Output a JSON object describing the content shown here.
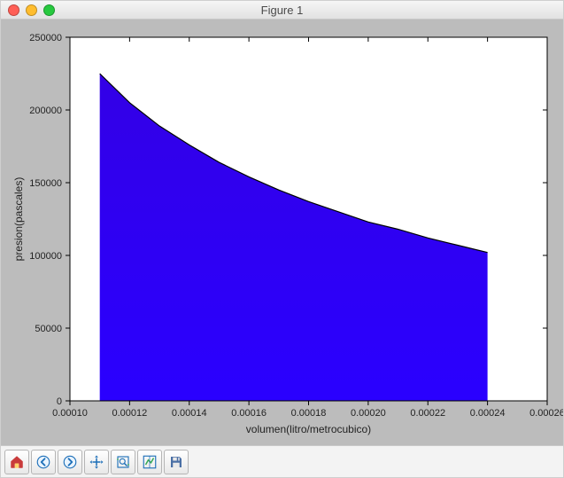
{
  "window": {
    "title": "Figure 1"
  },
  "chart_data": {
    "type": "area",
    "xlabel": "volumen(litro/metrocubico)",
    "ylabel": "presion(pascales)",
    "xlim": [
      0.0001,
      0.00026
    ],
    "ylim": [
      0,
      250000
    ],
    "x_ticks": [
      0.0001,
      0.00012,
      0.00014,
      0.00016,
      0.00018,
      0.0002,
      0.00022,
      0.00024,
      0.00026
    ],
    "y_ticks": [
      0,
      50000,
      100000,
      150000,
      200000,
      250000
    ],
    "x_tick_labels": [
      "0.00010",
      "0.00012",
      "0.00014",
      "0.00016",
      "0.00018",
      "0.00020",
      "0.00022",
      "0.00024",
      "0.00026"
    ],
    "y_tick_labels": [
      "0",
      "50000",
      "100000",
      "150000",
      "200000",
      "250000"
    ],
    "fill_color": "#2a00ff",
    "fill_color_top": "#3300e6",
    "line_color": "#000000",
    "series": [
      {
        "name": "presion",
        "x": [
          0.00011,
          0.00012,
          0.00013,
          0.00014,
          0.00015,
          0.00016,
          0.00017,
          0.00018,
          0.00019,
          0.0002,
          0.00021,
          0.00022,
          0.00023,
          0.00024
        ],
        "y": [
          225000,
          205000,
          189000,
          176000,
          164000,
          154000,
          145000,
          137000,
          130000,
          123000,
          118000,
          112000,
          107000,
          102000
        ]
      }
    ]
  },
  "toolbar": {
    "buttons": [
      {
        "name": "home-icon",
        "label": "Home"
      },
      {
        "name": "back-icon",
        "label": "Back"
      },
      {
        "name": "forward-icon",
        "label": "Forward"
      },
      {
        "name": "pan-icon",
        "label": "Pan"
      },
      {
        "name": "zoom-icon",
        "label": "Zoom"
      },
      {
        "name": "subplots-icon",
        "label": "Subplots"
      },
      {
        "name": "save-icon",
        "label": "Save"
      }
    ]
  }
}
